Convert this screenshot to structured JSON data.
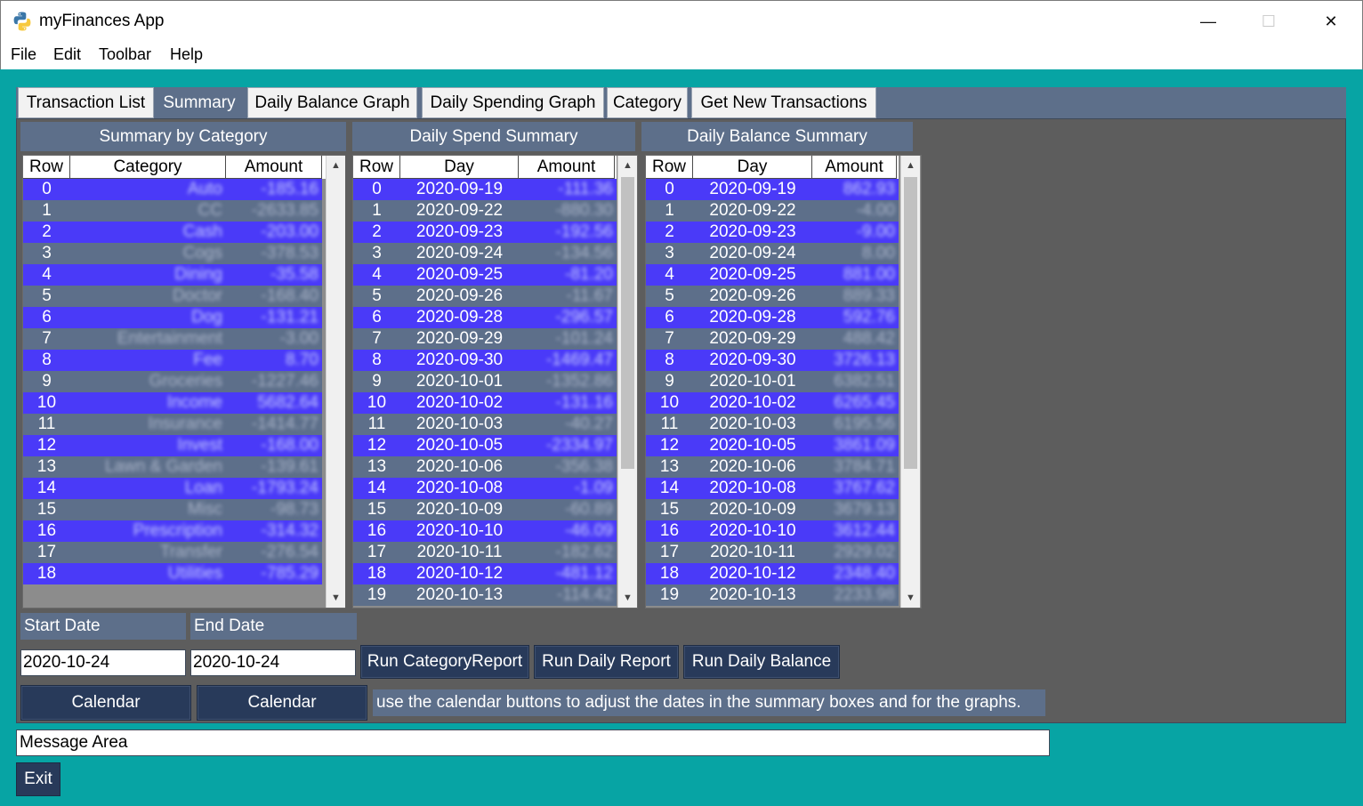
{
  "window": {
    "title": "myFinances App",
    "minimize_glyph": "—",
    "maximize_glyph": "☐",
    "close_glyph": "✕"
  },
  "menu": [
    "File",
    "Edit",
    "Toolbar",
    "Help"
  ],
  "tabs": [
    {
      "label": "Transaction List",
      "active": false
    },
    {
      "label": "Summary",
      "active": true
    },
    {
      "label": "Daily Balance Graph",
      "active": false
    },
    {
      "label": "Daily Spending Graph",
      "active": false
    },
    {
      "label": "Category",
      "active": false
    },
    {
      "label": "Get New Transactions",
      "active": false
    }
  ],
  "category_summary": {
    "title": "Summary by Category",
    "headers": [
      "Row",
      "Category",
      "Amount"
    ],
    "rows": [
      [
        "0",
        "Auto",
        "-185.16"
      ],
      [
        "1",
        "CC",
        "-2633.85"
      ],
      [
        "2",
        "Cash",
        "-203.00"
      ],
      [
        "3",
        "Cogs",
        "-378.53"
      ],
      [
        "4",
        "Dining",
        "-35.58"
      ],
      [
        "5",
        "Doctor",
        "-168.40"
      ],
      [
        "6",
        "Dog",
        "-131.21"
      ],
      [
        "7",
        "Entertainment",
        "-3.00"
      ],
      [
        "8",
        "Fee",
        "8.70"
      ],
      [
        "9",
        "Groceries",
        "-1227.46"
      ],
      [
        "10",
        "Income",
        "5682.64"
      ],
      [
        "11",
        "Insurance",
        "-1414.77"
      ],
      [
        "12",
        "Invest",
        "-168.00"
      ],
      [
        "13",
        "Lawn & Garden",
        "-139.61"
      ],
      [
        "14",
        "Loan",
        "-1793.24"
      ],
      [
        "15",
        "Misc",
        "-98.73"
      ],
      [
        "16",
        "Prescription",
        "-314.32"
      ],
      [
        "17",
        "Transfer",
        "-276.54"
      ],
      [
        "18",
        "Utilities",
        "-785.29"
      ]
    ]
  },
  "daily_spend": {
    "title": "Daily Spend Summary",
    "headers": [
      "Row",
      "Day",
      "Amount"
    ],
    "rows": [
      [
        "0",
        "2020-09-19",
        "-111.36"
      ],
      [
        "1",
        "2020-09-22",
        "-880.30"
      ],
      [
        "2",
        "2020-09-23",
        "-192.56"
      ],
      [
        "3",
        "2020-09-24",
        "-134.56"
      ],
      [
        "4",
        "2020-09-25",
        "-81.20"
      ],
      [
        "5",
        "2020-09-26",
        "-11.67"
      ],
      [
        "6",
        "2020-09-28",
        "-296.57"
      ],
      [
        "7",
        "2020-09-29",
        "-101.24"
      ],
      [
        "8",
        "2020-09-30",
        "-1469.47"
      ],
      [
        "9",
        "2020-10-01",
        "-1352.86"
      ],
      [
        "10",
        "2020-10-02",
        "-131.16"
      ],
      [
        "11",
        "2020-10-03",
        "-40.27"
      ],
      [
        "12",
        "2020-10-05",
        "-2334.97"
      ],
      [
        "13",
        "2020-10-06",
        "-356.38"
      ],
      [
        "14",
        "2020-10-08",
        "-1.09"
      ],
      [
        "15",
        "2020-10-09",
        "-60.89"
      ],
      [
        "16",
        "2020-10-10",
        "-46.09"
      ],
      [
        "17",
        "2020-10-11",
        "-182.62"
      ],
      [
        "18",
        "2020-10-12",
        "-481.12"
      ],
      [
        "19",
        "2020-10-13",
        "-114.42"
      ]
    ]
  },
  "daily_balance": {
    "title": "Daily Balance Summary",
    "headers": [
      "Row",
      "Day",
      "Amount"
    ],
    "rows": [
      [
        "0",
        "2020-09-19",
        "862.93"
      ],
      [
        "1",
        "2020-09-22",
        "-4.00"
      ],
      [
        "2",
        "2020-09-23",
        "-9.00"
      ],
      [
        "3",
        "2020-09-24",
        "8.00"
      ],
      [
        "4",
        "2020-09-25",
        "881.00"
      ],
      [
        "5",
        "2020-09-26",
        "889.33"
      ],
      [
        "6",
        "2020-09-28",
        "592.76"
      ],
      [
        "7",
        "2020-09-29",
        "488.42"
      ],
      [
        "8",
        "2020-09-30",
        "3726.13"
      ],
      [
        "9",
        "2020-10-01",
        "6382.51"
      ],
      [
        "10",
        "2020-10-02",
        "6265.45"
      ],
      [
        "11",
        "2020-10-03",
        "6195.56"
      ],
      [
        "12",
        "2020-10-05",
        "3861.09"
      ],
      [
        "13",
        "2020-10-06",
        "3784.71"
      ],
      [
        "14",
        "2020-10-08",
        "3767.62"
      ],
      [
        "15",
        "2020-10-09",
        "3679.13"
      ],
      [
        "16",
        "2020-10-10",
        "3612.44"
      ],
      [
        "17",
        "2020-10-11",
        "2929.02"
      ],
      [
        "18",
        "2020-10-12",
        "2348.40"
      ],
      [
        "19",
        "2020-10-13",
        "2233.98"
      ]
    ]
  },
  "controls": {
    "start_label": "Start Date",
    "end_label": "End Date",
    "start_value": "2020-10-24",
    "end_value": "2020-10-24",
    "run_category": "Run CategoryReport",
    "run_daily": "Run Daily Report",
    "run_balance": "Run Daily Balance",
    "calendar_start": "Calendar",
    "calendar_end": "Calendar",
    "hint": "use the calendar buttons to adjust the dates in the summary boxes and for the graphs."
  },
  "message_area": "Message Area",
  "exit_label": "Exit",
  "scroll_up_glyph": "▲",
  "scroll_down_glyph": "▼",
  "colors": {
    "background": "#07a4a4",
    "panel": "#5d5d5d",
    "header_band": "#5d6f8a",
    "row_highlight": "#4a3af8",
    "button": "#283a5a"
  }
}
